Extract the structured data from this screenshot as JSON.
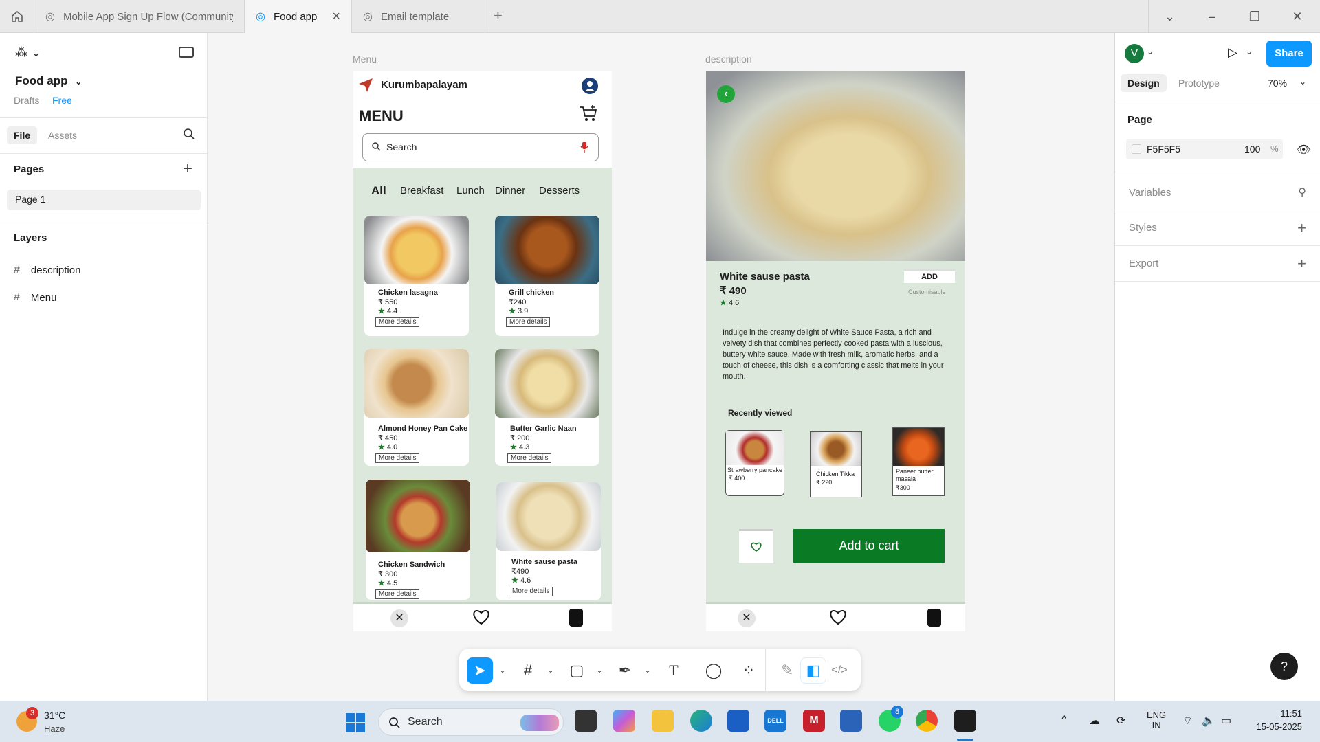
{
  "tabs": [
    {
      "label": "Mobile App Sign Up Flow (Community)"
    },
    {
      "label": "Food app"
    },
    {
      "label": "Email template"
    }
  ],
  "left": {
    "file_name": "Food app",
    "drafts": "Drafts",
    "plan": "Free",
    "tab_file": "File",
    "tab_assets": "Assets",
    "pages_title": "Pages",
    "page1": "Page 1",
    "layers_title": "Layers",
    "layers": [
      {
        "name": "description"
      },
      {
        "name": "Menu"
      }
    ]
  },
  "canvas": {
    "menu_label": "Menu",
    "desc_label": "description"
  },
  "menu": {
    "location": "Kurumbapalayam",
    "title": "MENU",
    "search_placeholder": "Search",
    "categories": [
      "All",
      "Breakfast",
      "Lunch",
      "Dinner",
      "Desserts"
    ],
    "items": [
      {
        "name": "Chicken lasagna",
        "price": "₹ 550",
        "rating": "4.4",
        "more": "More details"
      },
      {
        "name": "Grill chicken",
        "price": "₹240",
        "rating": "3.9",
        "more": "More details"
      },
      {
        "name": "Almond Honey Pan Cake",
        "price": "₹ 450",
        "rating": "4.0",
        "more": "More details"
      },
      {
        "name": "Butter Garlic Naan",
        "price": "₹ 200",
        "rating": "4.3",
        "more": "More details"
      },
      {
        "name": "Chicken Sandwich",
        "price": "₹ 300",
        "rating": "4.5",
        "more": "More details"
      },
      {
        "name": "White sause pasta",
        "price": "₹490",
        "rating": "4.6",
        "more": "More details"
      }
    ]
  },
  "desc": {
    "name": "White sause pasta",
    "price": "₹ 490",
    "rating": "4.6",
    "add": "ADD",
    "custom": "Customisable",
    "text": "Indulge in the creamy delight of White Sauce Pasta, a rich and velvety dish that combines perfectly cooked pasta with a luscious, buttery white sauce. Made with fresh milk, aromatic herbs, and a touch of cheese, this dish is a comforting classic that melts in your mouth.",
    "recent_title": "Recently viewed",
    "recent": [
      {
        "name": "Strawberry pancake",
        "price": "₹ 400"
      },
      {
        "name": "Chicken Tikka",
        "price": "₹ 220"
      },
      {
        "name": "Paneer butter masala",
        "price": "₹300"
      }
    ],
    "cart": "Add to cart"
  },
  "right": {
    "avatar": "V",
    "share": "Share",
    "design": "Design",
    "prototype": "Prototype",
    "zoom": "70%",
    "page_title": "Page",
    "page_color": "F5F5F5",
    "opacity": "100",
    "pct": "%",
    "variables": "Variables",
    "styles": "Styles",
    "export": "Export",
    "help": "?"
  },
  "taskbar": {
    "temp": "31°C",
    "weather": "Haze",
    "badge": "3",
    "search": "Search",
    "lang1": "ENG",
    "lang2": "IN",
    "time": "11:51",
    "date": "15-05-2025",
    "wa_badge": "8"
  },
  "colors": {
    "accent": "#0d99ff",
    "green": "#0b7a25",
    "phone_bg": "#dde8dc"
  }
}
